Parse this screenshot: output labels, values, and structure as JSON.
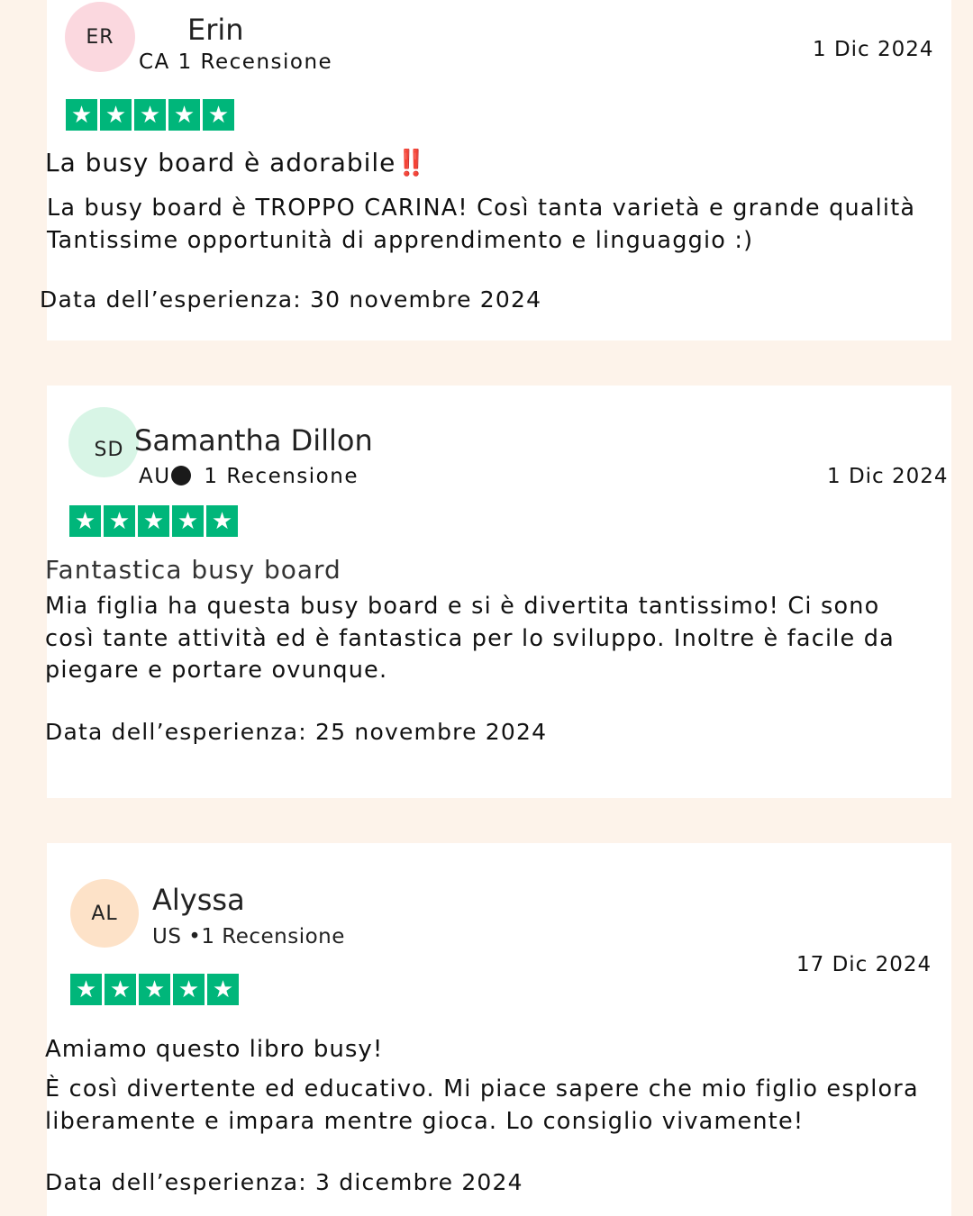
{
  "reviews": [
    {
      "initials": "ER",
      "avatar_color": "#fbd8df",
      "name": "Erin",
      "country": "CA",
      "count_label": "1 Recensione",
      "date": "1 Dic 2024",
      "rating": 5,
      "title": "La busy board è adorabile‼️",
      "body_lines": [
        "La busy board è TROPPO CARINA! Così tanta varietà e grande qualità",
        "Tantissime opportunità di apprendimento e linguaggio :)"
      ],
      "experience": "Data dell’esperienza: 30 novembre 2024"
    },
    {
      "initials": "SD",
      "avatar_color": "#d8f5e6",
      "name": "Samantha Dillon",
      "country": "AU",
      "count_label": "1 Recensione",
      "date": "1 Dic 2024",
      "rating": 5,
      "title": "Fantastica busy board",
      "body_lines": [
        "Mia figlia ha questa busy board e si è divertita tantissimo! Ci sono",
        "così tante attività ed è fantastica per lo sviluppo. Inoltre è facile da",
        "piegare e portare ovunque."
      ],
      "experience": "Data dell’esperienza: 25 novembre 2024"
    },
    {
      "initials": "AL",
      "avatar_color": "#fde2c8",
      "name": "Alyssa",
      "country": "US",
      "count_label": "•1 Recensione",
      "date": "17 Dic 2024",
      "rating": 5,
      "title": "Amiamo questo libro busy!",
      "body_lines": [
        "È così divertente ed educativo. Mi piace sapere che mio figlio esplora",
        "liberamente e impara mentre gioca. Lo consiglio vivamente!"
      ],
      "experience": "Data dell’esperienza: 3 dicembre 2024"
    }
  ],
  "colors": {
    "background": "#fdf3ea",
    "card": "#ffffff",
    "star_green": "#00b67a"
  },
  "icons": {
    "star": "star-icon",
    "separator": "dot-icon"
  }
}
